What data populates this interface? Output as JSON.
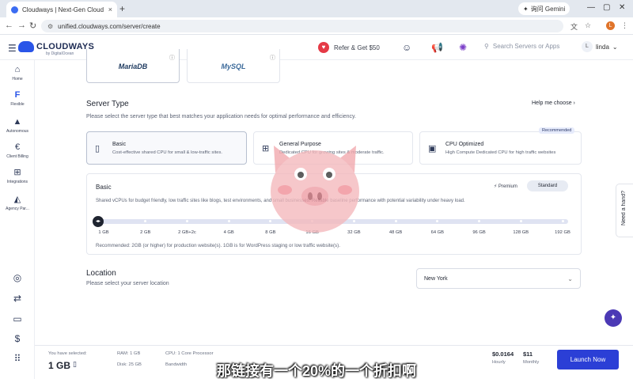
{
  "browser": {
    "tab_title": "Cloudways | Next-Gen Cloud",
    "tab_close": "×",
    "new_tab": "+",
    "gemini_label": "询问 Gemini",
    "url": "unified.cloudways.com/server/create",
    "profile_initial": "L"
  },
  "header": {
    "logo": "CLOUDWAYS",
    "logo_sub": "by DigitalOcean",
    "refer": "Refer & Get $50",
    "search_placeholder": "Search Servers or Apps",
    "user_initial": "L",
    "user_name": "linda"
  },
  "sidebar": {
    "items": [
      {
        "label": "Home",
        "icon": "home-icon"
      },
      {
        "label": "Flexible",
        "icon": "flexible-icon"
      },
      {
        "label": "Autonomous",
        "icon": "autonomous-icon"
      },
      {
        "label": "Client Billing",
        "icon": "billing-icon"
      },
      {
        "label": "Integrations",
        "icon": "integrations-icon"
      },
      {
        "label": "Agency Par...",
        "icon": "agency-icon"
      }
    ]
  },
  "databases": [
    {
      "name": "MariaDB",
      "selected": true
    },
    {
      "name": "MySQL",
      "selected": false
    }
  ],
  "server_type": {
    "title": "Server Type",
    "description": "Please select the server type that best matches your application needs for optimal performance and efficiency.",
    "help_link": "Help me choose",
    "recommended_badge": "Recommended",
    "options": [
      {
        "title": "Basic",
        "desc": "Cost-effective shared CPU for small & low-traffic sites.",
        "icon": "basic-server-icon"
      },
      {
        "title": "General Purpose",
        "desc": "Dedicated CPU for growing sites & moderate traffic.",
        "icon": "general-purpose-icon"
      },
      {
        "title": "CPU Optimized",
        "desc": "High Compute Dedicated CPU for high traffic websites",
        "icon": "cpu-optimized-icon"
      }
    ]
  },
  "size": {
    "title": "Basic",
    "premium_label": "Premium",
    "standard_label": "Standard",
    "description": "Shared vCPUs for budget friendly, low traffic sites like blogs, test environments, and small businesses. Reliable baseline performance with potential variability under heavy load.",
    "ticks": [
      "1 GB",
      "2 GB",
      "2 GB+2c",
      "4 GB",
      "8 GB",
      "16 GB",
      "32 GB",
      "48 GB",
      "64 GB",
      "96 GB",
      "128 GB",
      "192 GB"
    ],
    "selected_index": 0,
    "recommendation": "Recommended: 2GB (or higher) for production website(s). 1GB is for WordPress staging or low traffic website(s)."
  },
  "location": {
    "title": "Location",
    "description": "Please select your server location",
    "selected": "New York"
  },
  "need_hand": "Need a hand?",
  "summary": {
    "selected_label": "You have selected:",
    "selected_value": "1 GB",
    "ram": "RAM: 1 GB",
    "disk": "Disk: 25 GB",
    "cpu": "CPU: 1 Core Processor",
    "bandwidth": "Bandwidth",
    "hourly_price": "$0.0164",
    "hourly_label": "Hourly",
    "monthly_price": "$11",
    "monthly_label": "Monthly",
    "launch": "Launch Now"
  },
  "subtitle": "那链接有一个20%的一个折扣啊"
}
